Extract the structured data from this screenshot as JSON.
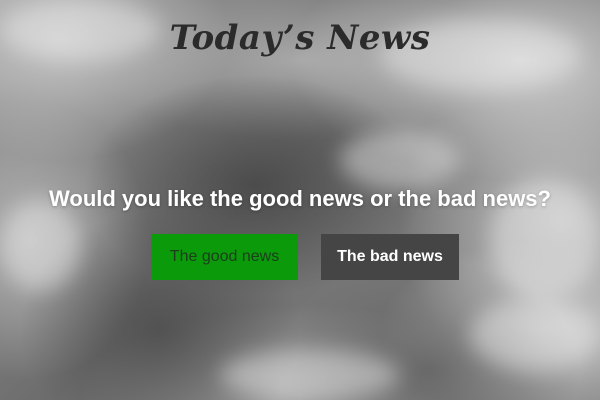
{
  "page": {
    "title": "Today’s News",
    "question": "Would you like the good news or the bad news?"
  },
  "buttons": {
    "good_label": "The good news",
    "bad_label": "The bad news"
  },
  "colors": {
    "good_button_bg": "#0a9a0a",
    "bad_button_bg": "#454545",
    "question_text": "#ffffff",
    "title_text": "#2b2b2b"
  }
}
